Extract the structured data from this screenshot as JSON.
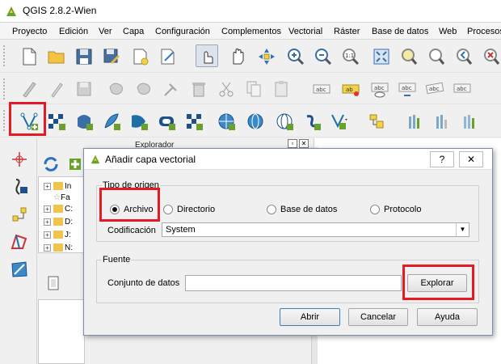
{
  "app": {
    "title": "QGIS 2.8.2-Wien"
  },
  "menu": [
    "Proyecto",
    "Edición",
    "Ver",
    "Capa",
    "Configuración",
    "Complementos",
    "Vectorial",
    "Ráster",
    "Base de datos",
    "Web",
    "Procesos"
  ],
  "explorer": {
    "title": "Explorador",
    "tree": [
      "In",
      "Fa",
      "C:",
      "D:",
      "J:",
      "N:"
    ]
  },
  "dialog": {
    "title": "Añadir capa vectorial",
    "help_button": "?",
    "close_button": "✕",
    "source_type": {
      "label": "Tipo de origen",
      "options": [
        "Archivo",
        "Directorio",
        "Base de datos",
        "Protocolo"
      ],
      "selected": "Archivo"
    },
    "encoding": {
      "label": "Codificación",
      "value": "System"
    },
    "source": {
      "label": "Fuente",
      "dataset_label": "Conjunto de datos",
      "dataset_value": "",
      "browse_button": "Explorar"
    },
    "buttons": {
      "open": "Abrir",
      "cancel": "Cancelar",
      "help": "Ayuda"
    }
  },
  "colors": {
    "highlight": "#e51a22",
    "qgis_green": "#69a22b"
  },
  "icons": {
    "toolbar_1": [
      "new-project-icon",
      "open-project-icon",
      "save-project-icon",
      "save-as-icon",
      "new-print-composer-icon",
      "composer-manager-icon",
      "touch-zoom-icon",
      "pan-icon",
      "pan-to-selection-icon",
      "zoom-in-icon",
      "zoom-out-icon",
      "zoom-actual-icon",
      "zoom-full-icon",
      "zoom-to-selection-icon",
      "zoom-to-layer-icon",
      "zoom-last-icon",
      "zoom-next-icon"
    ],
    "toolbar_2": [
      "current-edits-icon",
      "toggle-editing-icon",
      "save-edits-icon",
      "add-feature-icon",
      "move-feature-icon",
      "node-tool-icon",
      "delete-selected-icon",
      "cut-features-icon",
      "copy-features-icon",
      "paste-features-icon",
      "label-icon",
      "pin-labels-icon",
      "show-hide-labels-icon",
      "move-label-icon",
      "rotate-label-icon",
      "change-label-icon"
    ],
    "toolbar_3": [
      "add-vector-layer-icon",
      "add-raster-layer-icon",
      "add-postgis-layer-icon",
      "add-spatialite-layer-icon",
      "add-mssql-layer-icon",
      "add-oracle-layer-icon",
      "add-wms-layer-icon",
      "add-wcs-layer-icon",
      "add-wfs-layer-icon",
      "add-delimited-text-layer-icon",
      "new-shapefile-layer-icon",
      "add-virtual-layer-icon",
      "attribute-table-icon",
      "stats-icon",
      "graph-icon"
    ],
    "left": [
      "digitize-icon",
      "georeferencer-icon",
      "capture-point-icon",
      "add-vector-layer-icon",
      "grass-icon"
    ]
  }
}
